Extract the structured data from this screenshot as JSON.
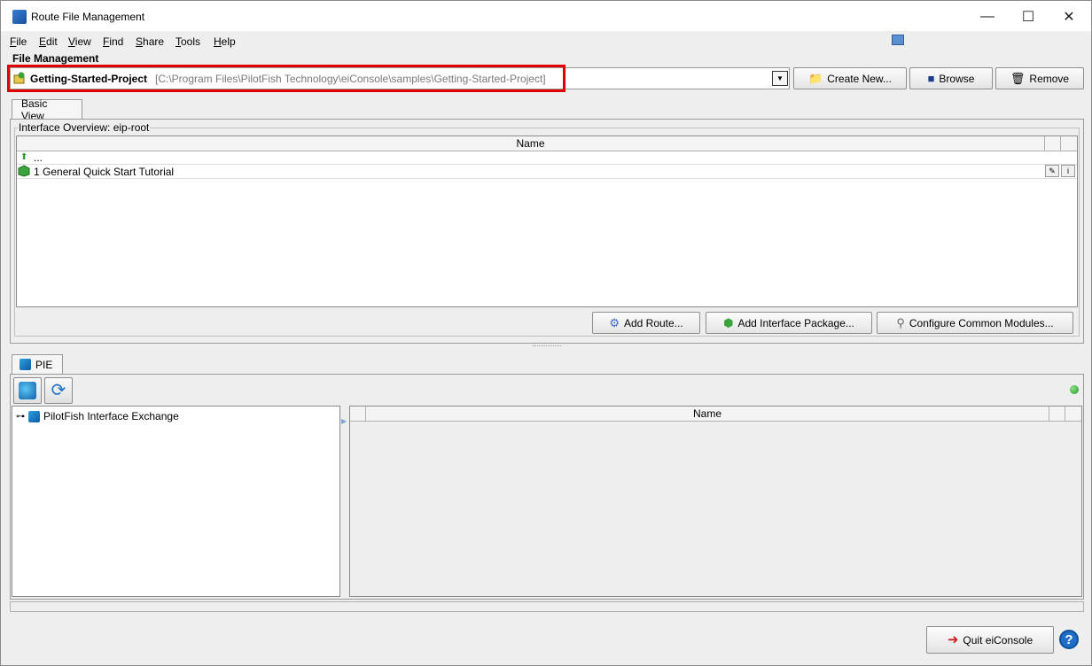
{
  "window": {
    "title": "Route File Management",
    "minimize": "—",
    "maximize": "☐",
    "close": "✕"
  },
  "menu": {
    "items": [
      {
        "label": "File",
        "underline": "F",
        "rest": "ile"
      },
      {
        "label": "Edit",
        "underline": "E",
        "rest": "dit"
      },
      {
        "label": "View",
        "underline": "V",
        "rest": "iew"
      },
      {
        "label": "Find",
        "underline": "F",
        "rest": "ind"
      },
      {
        "label": "Share",
        "underline": "S",
        "rest": "hare"
      },
      {
        "label": "Tools",
        "underline": "T",
        "rest": "ools"
      },
      {
        "label": "Help",
        "underline": "H",
        "rest": "elp"
      }
    ]
  },
  "file_management": {
    "section_label": "File Management",
    "project_name": "Getting-Started-Project",
    "project_path": "[C:\\Program Files\\PilotFish Technology\\eiConsole\\samples\\Getting-Started-Project]",
    "create_new_label": "Create New...",
    "browse_label": "Browse",
    "remove_label": "Remove"
  },
  "basic_view": {
    "tab_label": "Basic View",
    "overview_label": "Interface Overview: eip-root",
    "column_name": "Name",
    "rows": [
      {
        "name": "..."
      },
      {
        "name": "1 General Quick Start Tutorial"
      }
    ],
    "add_route_label": "Add Route...",
    "add_interface_package_label": "Add Interface Package...",
    "configure_common_modules_label": "Configure Common Modules..."
  },
  "pie": {
    "tab_label": "PIE",
    "tree_root": "PilotFish Interface Exchange",
    "column_name": "Name"
  },
  "footer": {
    "quit_label": "Quit eiConsole",
    "help_label": "?"
  },
  "colors": {
    "highlight": "#e00000",
    "status_ok": "#1c9a1c"
  }
}
